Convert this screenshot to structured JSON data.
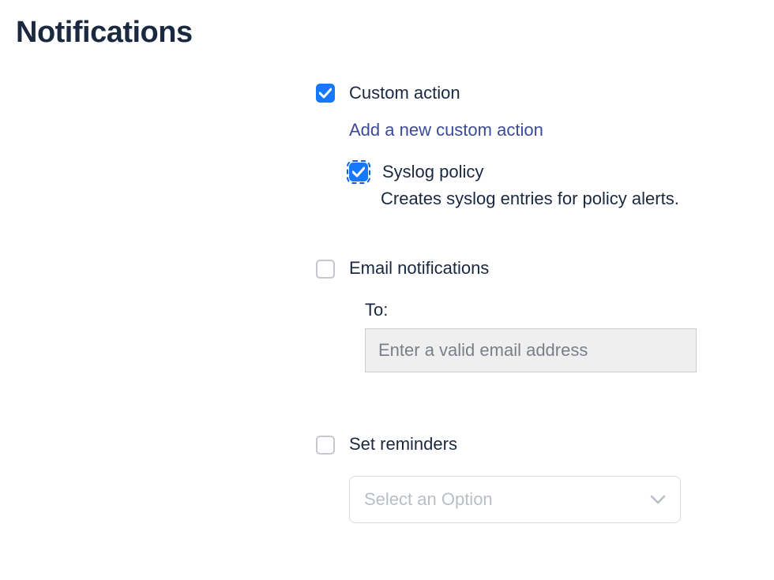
{
  "heading": "Notifications",
  "custom_action": {
    "label": "Custom action",
    "checked": true,
    "link_text": "Add a new custom action",
    "syslog": {
      "label": "Syslog policy",
      "checked": true,
      "description": "Creates syslog entries for policy alerts."
    }
  },
  "email_notifications": {
    "label": "Email notifications",
    "checked": false,
    "to_label": "To:",
    "placeholder": "Enter a valid email address",
    "value": ""
  },
  "set_reminders": {
    "label": "Set reminders",
    "checked": false,
    "select_placeholder": "Select an Option"
  }
}
